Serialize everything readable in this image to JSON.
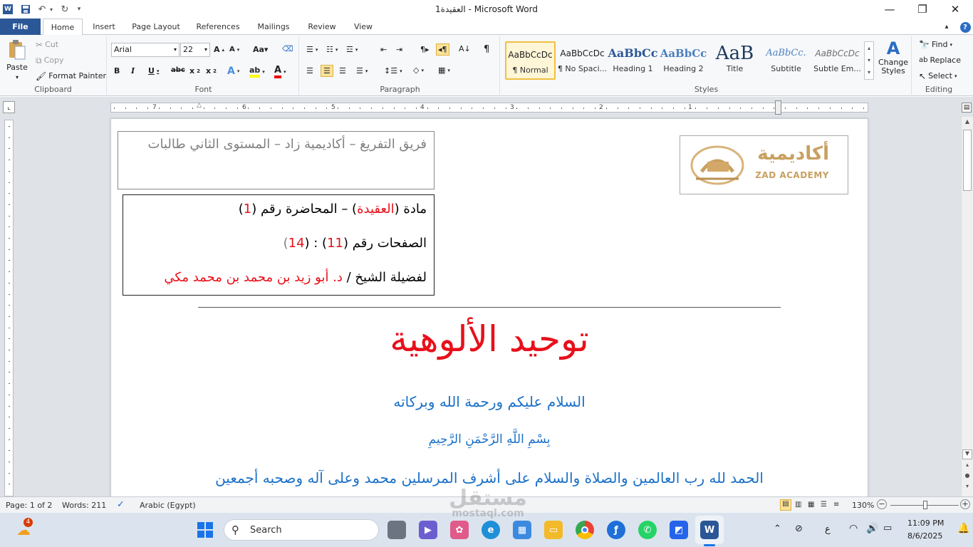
{
  "window": {
    "title": "العقيدة1 - Microsoft Word",
    "app_icon": "W",
    "minimize_icon": "minimize-icon",
    "restore_icon": "restore-icon",
    "close_icon": "close-icon"
  },
  "tabs": [
    {
      "label": "File"
    },
    {
      "label": "Home"
    },
    {
      "label": "Insert"
    },
    {
      "label": "Page Layout"
    },
    {
      "label": "References"
    },
    {
      "label": "Mailings"
    },
    {
      "label": "Review"
    },
    {
      "label": "View"
    }
  ],
  "ribbon": {
    "clipboard": {
      "label": "Clipboard",
      "paste": "Paste",
      "cut": "Cut",
      "copy": "Copy",
      "format_painter": "Format Painter"
    },
    "font": {
      "label": "Font",
      "font_name": "Arial",
      "font_size": "22"
    },
    "paragraph": {
      "label": "Paragraph"
    },
    "styles": {
      "label": "Styles",
      "items": [
        {
          "preview": "AaBbCcDc",
          "name": "¶ Normal"
        },
        {
          "preview": "AaBbCcDc",
          "name": "¶ No Spaci..."
        },
        {
          "preview": "AaBbCc",
          "name": "Heading 1"
        },
        {
          "preview": "AaBbCc",
          "name": "Heading 2"
        },
        {
          "preview": "AaB",
          "name": "Title"
        },
        {
          "preview": "AaBbCc.",
          "name": "Subtitle"
        },
        {
          "preview": "AaBbCcDc",
          "name": "Subtle Em..."
        }
      ],
      "change_styles": "Change Styles"
    },
    "editing": {
      "label": "Editing",
      "find": "Find",
      "replace": "Replace",
      "select": "Select"
    }
  },
  "ruler": {
    "numbers": [
      "7",
      "6",
      "5",
      "4",
      "3",
      "2",
      "1"
    ]
  },
  "document": {
    "header_box": "فريق التفريغ – أكاديمية زاد – المستوى الثاني طالبات",
    "info": {
      "line1_prefix": "مادة (",
      "line1_subject": "العقيدة",
      "line1_mid": ") – المحاضرة رقم (",
      "line1_num": "1",
      "line1_end": ")",
      "line2_prefix": "الصفحات رقم (",
      "line2_from": "11",
      "line2_mid": ") : (",
      "line2_to": "14",
      "line2_end": ")",
      "line3_prefix": "لفضيلة الشيخ / ",
      "line3_name": "د. أبو زيد بن محمد بن محمد مكي"
    },
    "logo": {
      "arabic": "أكاديمية",
      "english": "ZAD ACADEMY"
    },
    "heading": "توحيد الألوهية",
    "greeting": "السلام عليكم ورحمة الله وبركاته",
    "basmala": "بِسْمِ اللَّهِ الرَّحْمَنِ الرَّحِيمِ",
    "praise": "الحمد لله رب العالمين والصلاة والسلام على أشرف المرسلين محمد وعلى آله وصحبه أجمعين"
  },
  "status": {
    "page": "Page: 1 of 2",
    "words": "Words: 211",
    "language": "Arabic (Egypt)",
    "zoom": "130%"
  },
  "taskbar": {
    "search_placeholder": "Search",
    "weather_badge": "4",
    "lang_indicator": "ع",
    "time": "11:09 PM",
    "date": "8/6/2025"
  },
  "watermark": {
    "text1": "مستقل",
    "text2": "mostaql.com"
  },
  "colors": {
    "word_blue": "#2b5797",
    "doc_red": "#e8101a",
    "doc_blue": "#1a70c8",
    "doc_gray": "#808080",
    "logo_gold": "#c8a060"
  }
}
